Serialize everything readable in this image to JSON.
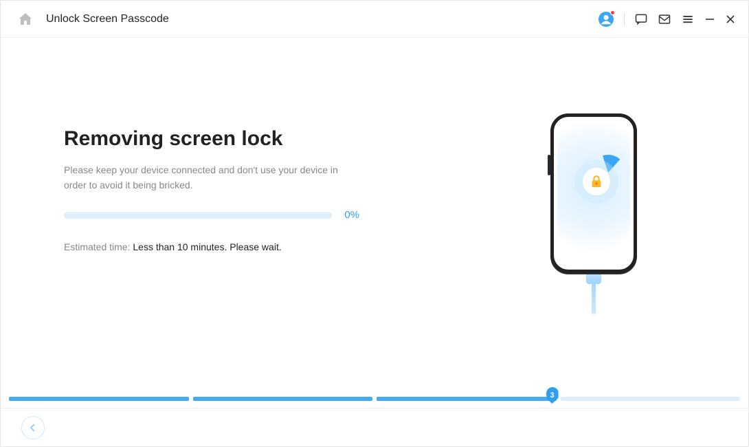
{
  "titlebar": {
    "title": "Unlock Screen Passcode"
  },
  "main": {
    "heading": "Removing screen lock",
    "description": "Please keep your device connected and don't use your device in order to avoid it being bricked.",
    "progress_percent_label": "0%",
    "eta_label": "Estimated time: ",
    "eta_value": "Less than 10 minutes. Please wait."
  },
  "steps": {
    "current_index_label": "3"
  }
}
